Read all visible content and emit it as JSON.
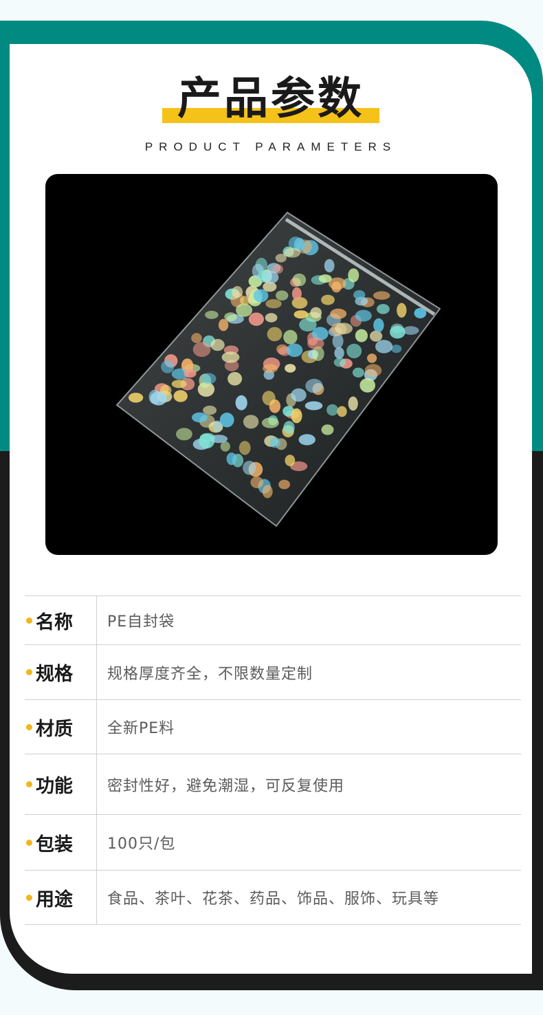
{
  "header": {
    "title": "产品参数",
    "subtitle": "PRODUCT PARAMETERS"
  },
  "colors": {
    "teal": "#008a82",
    "dark": "#1c1c1c",
    "accent": "#f5c21a",
    "dot": "#f2b61b"
  },
  "product_image": {
    "description_icon": "zip-bag-of-candies-photo"
  },
  "params": [
    {
      "label": "名称",
      "value": "PE自封袋"
    },
    {
      "label": "规格",
      "value": "规格厚度齐全，不限数量定制"
    },
    {
      "label": "材质",
      "value": "全新PE料"
    },
    {
      "label": "功能",
      "value": "密封性好，避免潮湿，可反复使用"
    },
    {
      "label": "包装",
      "value": "100只/包"
    },
    {
      "label": "用途",
      "value": "食品、茶叶、花茶、药品、饰品、服饰、玩具等"
    }
  ]
}
